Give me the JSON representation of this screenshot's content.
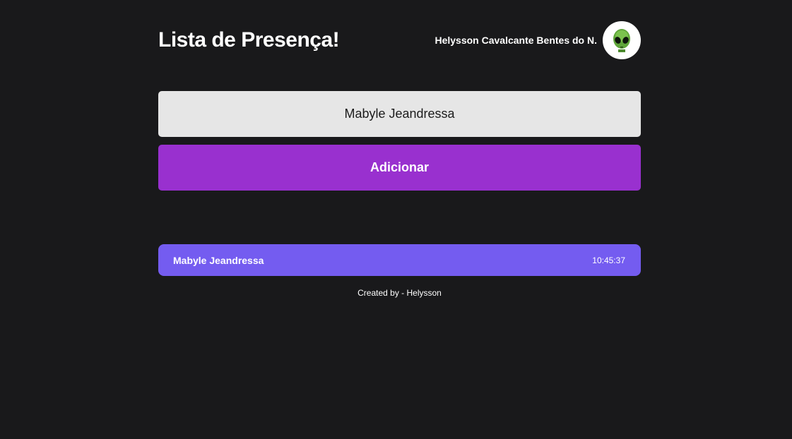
{
  "header": {
    "title": "Lista de Presença!",
    "user_name": "Helysson Cavalcante Bentes do N.",
    "avatar_icon": "alien-icon"
  },
  "form": {
    "input_value": "Mabyle Jeandressa",
    "button_label": "Adicionar"
  },
  "list": {
    "items": [
      {
        "name": "Mabyle Jeandressa",
        "time": "10:45:37"
      }
    ]
  },
  "footer": {
    "credit": "Created by - Helysson"
  },
  "colors": {
    "background": "#19191b",
    "input_bg": "#e6e6e6",
    "button": "#9930cf",
    "card": "#745cf0"
  }
}
